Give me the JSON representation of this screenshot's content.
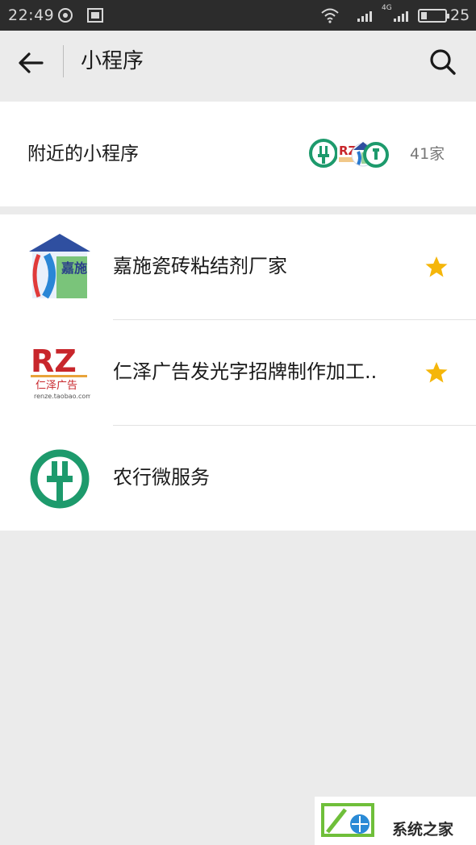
{
  "status_bar": {
    "time": "22:49",
    "network": "4G",
    "battery": "25",
    "battery_level": 0.25
  },
  "header": {
    "title": "小程序",
    "back_icon": "arrow-left-icon",
    "search_icon": "search-icon"
  },
  "nearby": {
    "label": "附近的小程序",
    "count": "41家"
  },
  "mini_programs": [
    {
      "name": "嘉施瓷砖粘结剂厂家",
      "starred": true,
      "logo_text": "嘉施"
    },
    {
      "name": "仁泽广告发光字招牌制作加工..",
      "starred": true,
      "logo_text": "RZ",
      "logo_subtext": "仁泽广告",
      "logo_url_text": "renze.taobao.com"
    },
    {
      "name": "农行微服务",
      "starred": false
    }
  ],
  "watermark": {
    "text": "系统之家"
  },
  "colors": {
    "abc_green": "#1d9a6c",
    "star_yellow": "#f5b60a",
    "rz_red": "#c8262b",
    "rz_orange": "#e8a33a",
    "jiashi_blue": "#2f4fa0"
  }
}
